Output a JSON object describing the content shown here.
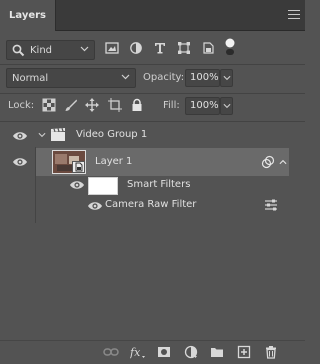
{
  "tab": {
    "title": "Layers"
  },
  "filter": {
    "kind_label": "Kind"
  },
  "blend": {
    "mode": "Normal",
    "opacity_label": "Opacity:",
    "opacity_value": "100%"
  },
  "lock": {
    "label": "Lock:",
    "fill_label": "Fill:",
    "fill_value": "100%"
  },
  "layers": {
    "group_name": "Video Group 1",
    "layer_name": "Layer 1",
    "smart_filters_label": "Smart Filters",
    "filter_name": "Camera Raw Filter"
  },
  "colors": {
    "panel": "#535353",
    "tabbar": "#3a3a3a",
    "selected_row": "#6a6a6a",
    "text": "#e1e1e1"
  }
}
